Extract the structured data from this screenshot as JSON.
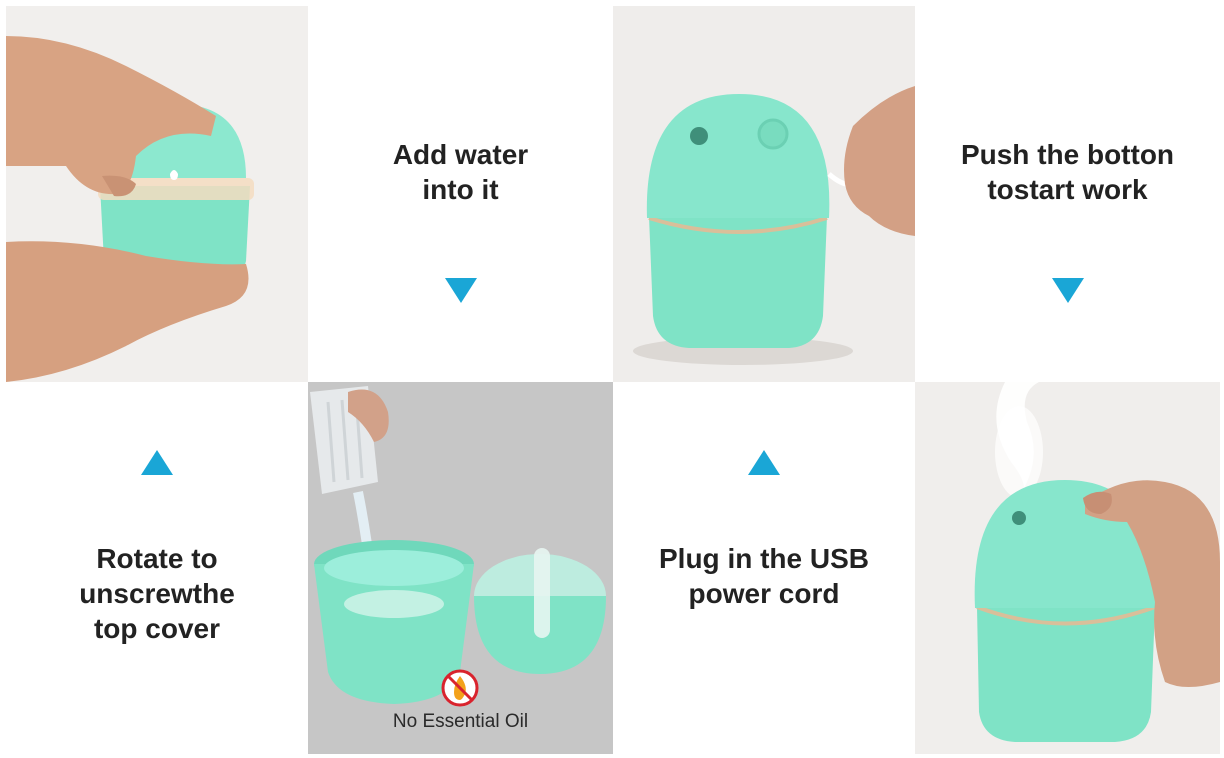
{
  "steps": {
    "add_water": {
      "caption": "Add water\ninto it"
    },
    "push_button": {
      "caption": "Push the botton\ntostart work"
    },
    "rotate_cover": {
      "caption": "Rotate to\nunscrewthe\ntop cover"
    },
    "plug_usb": {
      "caption": "Plug in the USB\npower cord"
    }
  },
  "warning": {
    "label": "No Essential Oil",
    "icon": "no-flame-icon"
  },
  "colors": {
    "accent_arrow": "#1aa6d6",
    "device_mint": "#7fe3c6",
    "warning_red": "#d9232d"
  }
}
